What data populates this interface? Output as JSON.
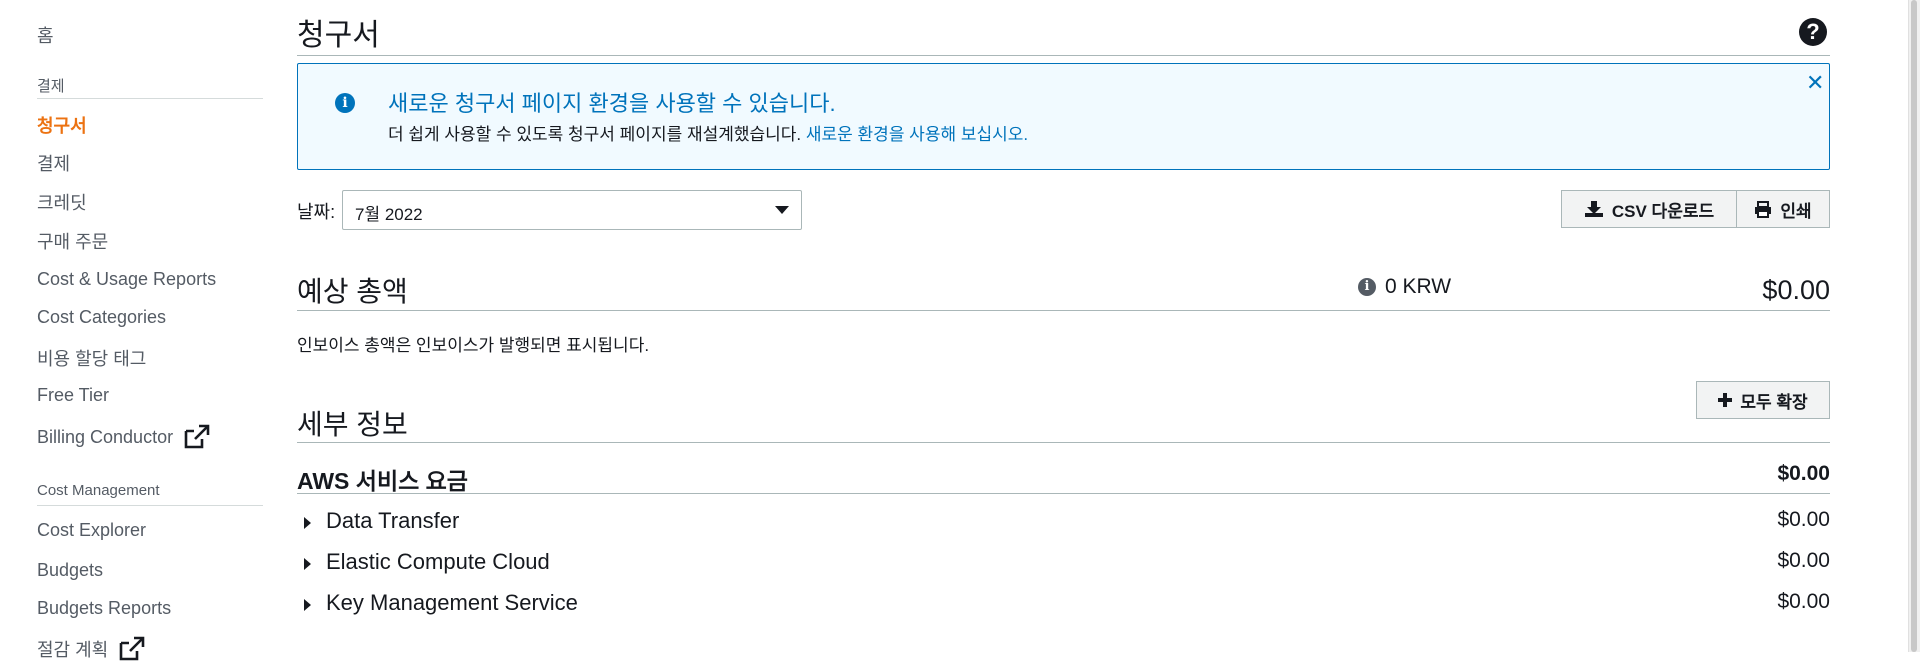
{
  "sidebar": {
    "home": "홈",
    "section_billing": "결제",
    "items": [
      {
        "label": "청구서",
        "active": true
      },
      {
        "label": "결제"
      },
      {
        "label": "크레딧"
      },
      {
        "label": "구매 주문"
      },
      {
        "label": "Cost & Usage Reports"
      },
      {
        "label": "Cost Categories"
      },
      {
        "label": "비용 할당 태그"
      },
      {
        "label": "Free Tier"
      },
      {
        "label": "Billing Conductor",
        "external": true
      }
    ],
    "section_cost_management": "Cost Management",
    "cm_items": [
      {
        "label": "Cost Explorer"
      },
      {
        "label": "Budgets"
      },
      {
        "label": "Budgets Reports"
      },
      {
        "label": "절감 계획",
        "external": true
      }
    ]
  },
  "page": {
    "title": "청구서"
  },
  "banner": {
    "title": "새로운 청구서 페이지 환경을 사용할 수 있습니다.",
    "text": "더 쉽게 사용할 수 있도록 청구서 페이지를 재설계했습니다.",
    "link": "새로운 환경을 사용해 보십시오."
  },
  "date_filter": {
    "label": "날짜:",
    "value": "7월 2022"
  },
  "actions": {
    "csv_download": "CSV 다운로드",
    "print": "인쇄",
    "expand_all": "모두 확장"
  },
  "estimated_total": {
    "title": "예상 총액",
    "krw": "0 KRW",
    "amount": "$0.00",
    "note": "인보이스 총액은 인보이스가 발행되면 표시됩니다."
  },
  "details": {
    "title": "세부 정보",
    "aws_services_label": "AWS 서비스 요금",
    "aws_services_amount": "$0.00",
    "services": [
      {
        "name": "Data Transfer",
        "amount": "$0.00"
      },
      {
        "name": "Elastic Compute Cloud",
        "amount": "$0.00"
      },
      {
        "name": "Key Management Service",
        "amount": "$0.00"
      }
    ]
  },
  "colors": {
    "accent_orange": "#ec7211",
    "link_blue": "#0073bb",
    "banner_bg": "#f1faff"
  }
}
